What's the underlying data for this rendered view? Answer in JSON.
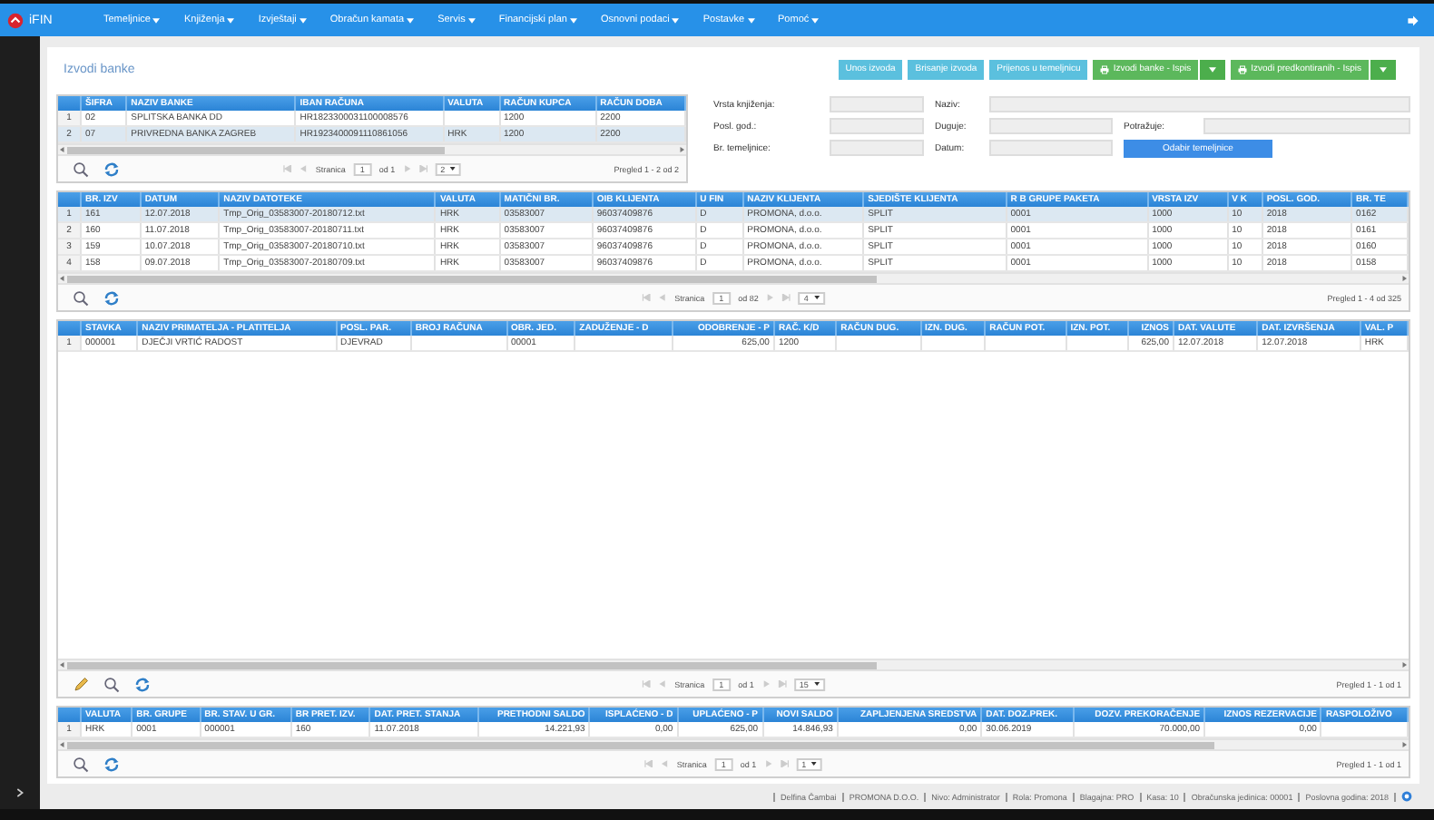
{
  "navbar": {
    "brand": "iFIN",
    "menu": [
      "Temeljnice",
      "Knjiženja",
      "Izvještaji",
      "Obračun kamata",
      "Servis",
      "Financijski plan",
      "Osnovni podaci",
      "Postavke",
      "Pomoć"
    ]
  },
  "page": {
    "title": "Izvodi banke"
  },
  "actions": [
    {
      "label": "Unos izvoda",
      "kind": "info"
    },
    {
      "label": "Brisanje izvoda",
      "kind": "info"
    },
    {
      "label": "Prijenos u temeljnicu",
      "kind": "info"
    },
    {
      "label": "Izvodi banke - Ispis",
      "kind": "print"
    },
    {
      "label": "Izvodi predkontiranih - Ispis",
      "kind": "print"
    }
  ],
  "form": [
    {
      "label": "Vrsta knjiženja:",
      "kind": "field"
    },
    {
      "label": "Naziv:",
      "kind": "wide"
    },
    {
      "label": "Posl. god.:",
      "kind": "field"
    },
    {
      "label": "Duguje:",
      "kind": "field"
    },
    {
      "label": "Potražuje:",
      "kind": "field"
    },
    {
      "label": "Br. temeljnice:",
      "kind": "field"
    },
    {
      "label": "Datum:",
      "kind": "field"
    },
    {
      "label": "Odabir temeljnice",
      "kind": "button"
    }
  ],
  "tables": [
    {
      "columns": [
        {
          "label": "ŠIFRA",
          "numeric": false
        },
        {
          "label": "NAZIV BANKE",
          "numeric": false
        },
        {
          "label": "IBAN RAČUNA",
          "numeric": false
        },
        {
          "label": "VALUTA",
          "numeric": false
        },
        {
          "label": "RAČUN KUPCA",
          "numeric": false
        },
        {
          "label": "RAČUN DOBA",
          "numeric": false
        }
      ],
      "rows": [
        {
          "num": "1",
          "selected": false,
          "cells": [
            "02",
            "SPLITSKA BANKA DD",
            "HR1823300031100008576",
            null,
            "1200",
            "2200"
          ]
        },
        {
          "num": "2",
          "selected": true,
          "cells": [
            "07",
            "PRIVREDNA BANKA ZAGREB",
            "HR1923400091110861056",
            "HRK",
            "1200",
            "2200"
          ]
        }
      ],
      "pager": {
        "edit_tool": false,
        "page_label": "Stranica",
        "page": "1",
        "of": "od 1",
        "page_size": "2",
        "summary": "Pregled 1 - 2 od 2"
      }
    },
    {
      "columns": [
        {
          "label": "BR. IZV",
          "numeric": false
        },
        {
          "label": "DATUM",
          "numeric": false
        },
        {
          "label": "NAZIV DATOTEKE",
          "numeric": false
        },
        {
          "label": "VALUTA",
          "numeric": false
        },
        {
          "label": "MATIČNI BR.",
          "numeric": false
        },
        {
          "label": "OIB KLIJENTA",
          "numeric": false
        },
        {
          "label": "U FIN",
          "numeric": false
        },
        {
          "label": "NAZIV KLIJENTA",
          "numeric": false
        },
        {
          "label": "SJEDIŠTE KLIJENTA",
          "numeric": false
        },
        {
          "label": "R B GRUPE PAKETA",
          "numeric": false
        },
        {
          "label": "VRSTA IZV",
          "numeric": false
        },
        {
          "label": "V K",
          "numeric": false
        },
        {
          "label": "POSL. GOD.",
          "numeric": false
        },
        {
          "label": "BR. TE",
          "numeric": false
        }
      ],
      "rows": [
        {
          "num": "1",
          "selected": true,
          "cells": [
            "161",
            "12.07.2018",
            "Tmp_Orig_03583007-20180712.txt",
            "HRK",
            "03583007",
            "96037409876",
            "D",
            "PROMONA, d.o.o.",
            "SPLIT",
            "0001",
            "1000",
            "10",
            "2018",
            "0162"
          ]
        },
        {
          "num": "2",
          "selected": false,
          "cells": [
            "160",
            "11.07.2018",
            "Tmp_Orig_03583007-20180711.txt",
            "HRK",
            "03583007",
            "96037409876",
            "D",
            "PROMONA, d.o.o.",
            "SPLIT",
            "0001",
            "1000",
            "10",
            "2018",
            "0161"
          ]
        },
        {
          "num": "3",
          "selected": false,
          "cells": [
            "159",
            "10.07.2018",
            "Tmp_Orig_03583007-20180710.txt",
            "HRK",
            "03583007",
            "96037409876",
            "D",
            "PROMONA, d.o.o.",
            "SPLIT",
            "0001",
            "1000",
            "10",
            "2018",
            "0160"
          ]
        },
        {
          "num": "4",
          "selected": false,
          "cells": [
            "158",
            "09.07.2018",
            "Tmp_Orig_03583007-20180709.txt",
            "HRK",
            "03583007",
            "96037409876",
            "D",
            "PROMONA, d.o.o.",
            "SPLIT",
            "0001",
            "1000",
            "10",
            "2018",
            "0158"
          ]
        }
      ],
      "pager": {
        "edit_tool": false,
        "page_label": "Stranica",
        "page": "1",
        "of": "od 82",
        "page_size": "4",
        "summary": "Pregled 1 - 4 od 325"
      }
    },
    {
      "columns": [
        {
          "label": "STAVKA",
          "numeric": false
        },
        {
          "label": "NAZIV PRIMATELJA - PLATITELJA",
          "numeric": false
        },
        {
          "label": "POSL. PAR.",
          "numeric": false
        },
        {
          "label": "BROJ RAČUNA"
        },
        {
          "label": "OBR. JED.",
          "numeric": false
        },
        {
          "label": "ZADUŽENJE - D"
        },
        {
          "label": "ODOBRENJE - P",
          "numeric": true
        },
        {
          "label": "RAČ. K/D",
          "numeric": false
        },
        {
          "label": "RAČUN DUG."
        },
        {
          "label": "IZN. DUG."
        },
        {
          "label": "RAČUN POT."
        },
        {
          "label": "IZN. POT."
        },
        {
          "label": "IZNOS",
          "numeric": true
        },
        {
          "label": "DAT. VALUTE",
          "numeric": false
        },
        {
          "label": "DAT. IZVRŠENJA",
          "numeric": false
        },
        {
          "label": "VAL. P",
          "numeric": false
        }
      ],
      "rows": [
        {
          "num": "1",
          "selected": false,
          "cells": [
            "000001",
            "DJEČJI VRTIĆ RADOST",
            "DJEVRAD",
            null,
            "00001",
            null,
            "625,00",
            "1200",
            null,
            null,
            null,
            null,
            "625,00",
            "12.07.2018",
            "12.07.2018",
            "HRK"
          ]
        }
      ],
      "pager": {
        "edit_tool": true,
        "page_label": "Stranica",
        "page": "1",
        "of": "od 1",
        "page_size": "15",
        "summary": "Pregled 1 - 1 od 1"
      }
    },
    {
      "columns": [
        {
          "label": "VALUTA",
          "numeric": false
        },
        {
          "label": "BR. GRUPE",
          "numeric": false
        },
        {
          "label": "BR. STAV. U GR.",
          "numeric": false
        },
        {
          "label": "BR PRET. IZV.",
          "numeric": false
        },
        {
          "label": "DAT. PRET. STANJA",
          "numeric": false
        },
        {
          "label": "PRETHODNI SALDO",
          "numeric": true
        },
        {
          "label": "ISPLAĆENO - D",
          "numeric": true
        },
        {
          "label": "UPLAĆENO - P",
          "numeric": true
        },
        {
          "label": "NOVI SALDO",
          "numeric": true
        },
        {
          "label": "ZAPLJENJENA SREDSTVA",
          "numeric": true
        },
        {
          "label": "DAT. DOZ.PREK.",
          "numeric": false
        },
        {
          "label": "DOZV. PREKORAČENJE",
          "numeric": true
        },
        {
          "label": "IZNOS REZERVACIJE",
          "numeric": true
        },
        {
          "label": "RASPOLOŽIVO"
        }
      ],
      "rows": [
        {
          "num": "1",
          "selected": false,
          "cells": [
            "HRK",
            "0001",
            "000001",
            "160",
            "11.07.2018",
            "14.221,93",
            "0,00",
            "625,00",
            "14.846,93",
            "0,00",
            "30.06.2019",
            "70.000,00",
            "0,00",
            null
          ]
        }
      ],
      "pager": {
        "edit_tool": false,
        "page_label": "Stranica",
        "page": "1",
        "of": "od 1",
        "page_size": "1",
        "summary": "Pregled 1 - 1 od 1"
      }
    }
  ],
  "status_bar": [
    "Delfina Čambai",
    "PROMONA D.O.O.",
    "Nivo: Administrator",
    "Rola: Promona",
    "Blagajna: PRO",
    "Kasa: 10",
    "Obračunska jedinica: 00001",
    "Poslovna godina: 2018"
  ]
}
